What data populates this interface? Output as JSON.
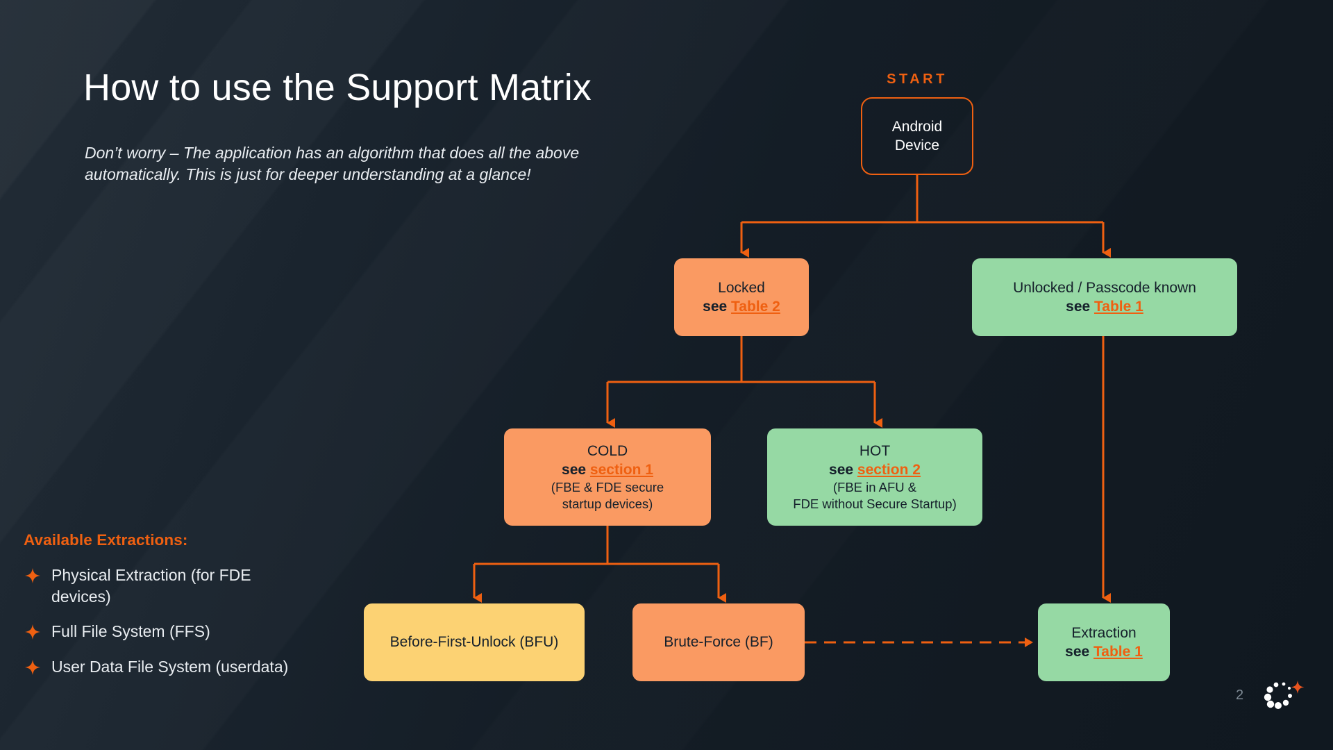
{
  "slide": {
    "title": "How to use the Support Matrix",
    "subtitle": "Don’t worry – The application has an algorithm that does all the above automatically. This is just for deeper understanding at a glance!",
    "page_number": "2"
  },
  "colors": {
    "background_dark": "#141d26",
    "accent_orange": "#ef6011",
    "node_orange": "#fa9a62",
    "node_green": "#96d9a4",
    "node_yellow": "#fcd273",
    "node_text": "#15202b",
    "body_text": "#e9edf1"
  },
  "extractions": {
    "heading": "Available Extractions:",
    "bullet_icon": "four-point-star-icon",
    "items": [
      "Physical Extraction (for FDE devices)",
      "Full File System (FFS)",
      "User Data File System (userdata)"
    ]
  },
  "flowchart": {
    "start_label": "START",
    "nodes": {
      "start": {
        "line1": "Android",
        "line2": "Device"
      },
      "locked": {
        "title": "Locked",
        "see_prefix": "see ",
        "ref": "Table 2"
      },
      "unlocked": {
        "title": "Unlocked / Passcode known",
        "see_prefix": "see ",
        "ref": "Table 1"
      },
      "cold": {
        "title": "COLD",
        "see_prefix": "see ",
        "ref": "section 1",
        "note1": "(FBE & FDE secure",
        "note2": "startup devices)"
      },
      "hot": {
        "title": "HOT",
        "see_prefix": "see ",
        "ref": "section 2",
        "note1": "(FBE in AFU &",
        "note2": "FDE without Secure Startup)"
      },
      "bfu": {
        "title": "Before-First-Unlock (BFU)"
      },
      "bf": {
        "title": "Brute-Force (BF)"
      },
      "extraction": {
        "title": "Extraction",
        "see_prefix": "see ",
        "ref": "Table 1"
      }
    }
  }
}
